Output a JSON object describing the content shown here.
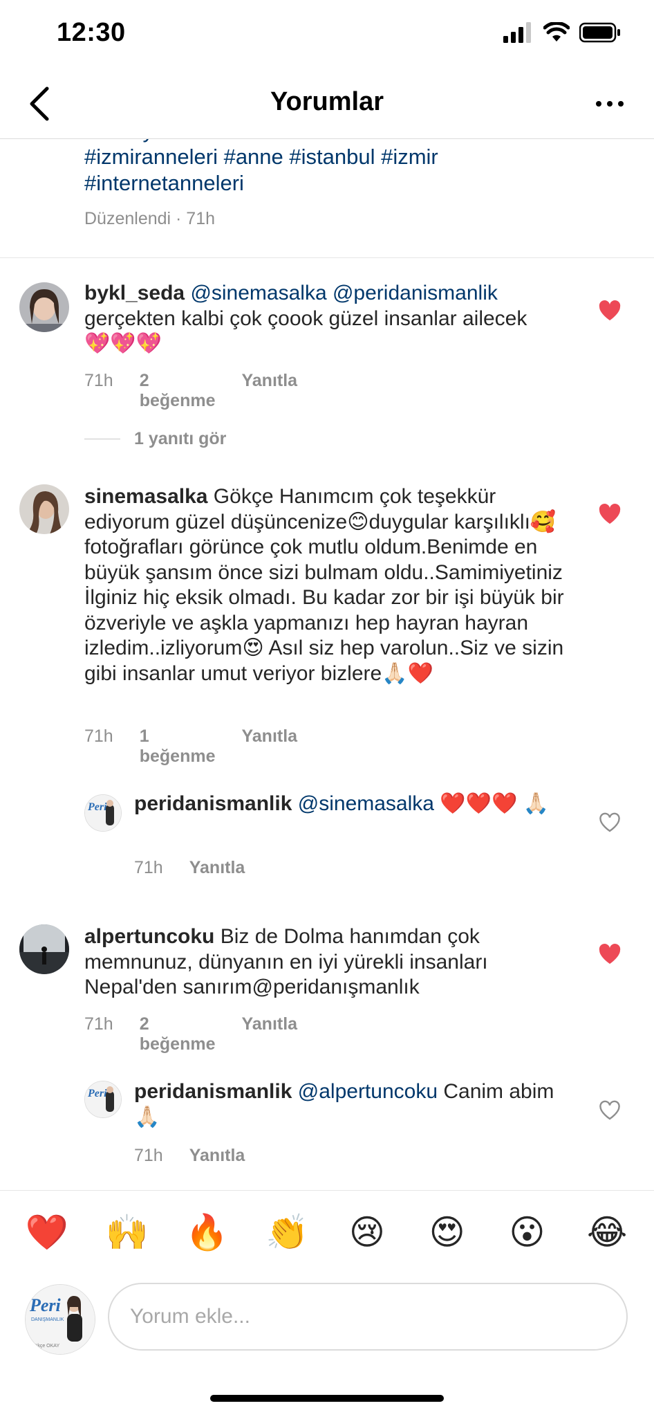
{
  "status": {
    "time": "12:30"
  },
  "nav": {
    "title": "Yorumlar"
  },
  "caption": {
    "cut_line": "#antalyaanneleri #istanbulanneleri #ankaraanneleri",
    "line1": "#izmiranneleri #anne #istanbul #izmir",
    "line2": "#internetanneleri",
    "meta": "Düzenlendi · 71h"
  },
  "comments": [
    {
      "user": "bykl_seda",
      "text": "@sinemasalka @peridanismanlik gerçekten kalbi çok çoook güzel insanlar ailecek💖💖💖",
      "mentions": "@sinemasalka @peridanismanlik",
      "body": " gerçekten kalbi çok çoook güzel insanlar ailecek💖💖💖",
      "time": "71h",
      "likes": "2 beğenme",
      "reply": "Yanıtla",
      "liked": true,
      "view_replies": "1 yanıtı gör"
    },
    {
      "user": "sinemasalka",
      "body": " Gökçe Hanımcım çok teşekkür ediyorum güzel düşüncenize😊duygular karşılıklı🥰fotoğrafları görünce çok mutlu oldum.Benimde en büyük şansım önce sizi bulmam oldu..Samimiyetiniz İlginiz hiç eksik olmadı. Bu kadar zor bir işi büyük bir özveriyle ve aşkla yapmanızı hep hayran hayran izledim..izliyorum😍 Asıl siz hep varolun..Siz ve sizin gibi insanlar umut veriyor bizlere🙏🏻❤️",
      "time": "71h",
      "likes": "1 beğenme",
      "reply": "Yanıtla",
      "liked": true
    },
    {
      "user": "peridanismanlik",
      "mentions": "@sinemasalka",
      "body": " ❤️❤️❤️ 🙏🏻",
      "time": "71h",
      "reply": "Yanıtla",
      "liked": false
    },
    {
      "user": "alpertuncoku",
      "body": " Biz de Dolma hanımdan çok memnunuz, dünyanın en iyi yürekli insanları Nepal'den sanırım@peridanışmanlık",
      "time": "71h",
      "likes": "2 beğenme",
      "reply": "Yanıtla",
      "liked": true
    },
    {
      "user": "peridanismanlik",
      "mentions": "@alpertuncoku",
      "body": " Canim abim🙏🏻",
      "time": "71h",
      "reply": "Yanıtla",
      "liked": false
    }
  ],
  "reactions": [
    "❤️",
    "🙌",
    "🔥",
    "👏",
    "😢",
    "😍",
    "😮",
    "😂"
  ],
  "composer": {
    "placeholder": "Yorum ekle...",
    "avatar_brand": "Peri",
    "avatar_sub": "DANIŞMANLIK",
    "avatar_name": "Gökçe OKAY"
  },
  "colors": {
    "like_red": "#ed4956",
    "mention_blue": "#00376b",
    "meta_gray": "#8e8e8e"
  }
}
